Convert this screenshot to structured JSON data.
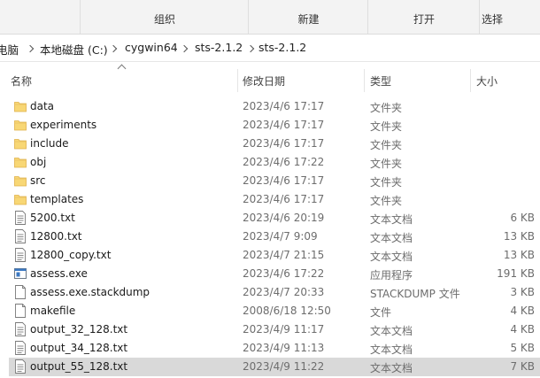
{
  "ribbon": {
    "groups": [
      "组织",
      "新建",
      "打开",
      "选择"
    ]
  },
  "breadcrumb": {
    "items": [
      "电脑",
      "本地磁盘 (C:)",
      "cygwin64",
      "sts-2.1.2",
      "sts-2.1.2"
    ]
  },
  "columns": {
    "name": "名称",
    "date": "修改日期",
    "type": "类型",
    "size": "大小"
  },
  "files": [
    {
      "name": "data",
      "date": "2023/4/6 17:17",
      "type": "文件夹",
      "size": "",
      "icon": "folder-icon"
    },
    {
      "name": "experiments",
      "date": "2023/4/6 17:17",
      "type": "文件夹",
      "size": "",
      "icon": "folder-icon"
    },
    {
      "name": "include",
      "date": "2023/4/6 17:17",
      "type": "文件夹",
      "size": "",
      "icon": "folder-icon"
    },
    {
      "name": "obj",
      "date": "2023/4/6 17:22",
      "type": "文件夹",
      "size": "",
      "icon": "folder-icon"
    },
    {
      "name": "src",
      "date": "2023/4/6 17:17",
      "type": "文件夹",
      "size": "",
      "icon": "folder-icon"
    },
    {
      "name": "templates",
      "date": "2023/4/6 17:17",
      "type": "文件夹",
      "size": "",
      "icon": "folder-icon"
    },
    {
      "name": "5200.txt",
      "date": "2023/4/6 20:19",
      "type": "文本文档",
      "size": "6 KB",
      "icon": "text-file-icon"
    },
    {
      "name": "12800.txt",
      "date": "2023/4/7 9:09",
      "type": "文本文档",
      "size": "13 KB",
      "icon": "text-file-icon"
    },
    {
      "name": "12800_copy.txt",
      "date": "2023/4/7 21:15",
      "type": "文本文档",
      "size": "13 KB",
      "icon": "text-file-icon"
    },
    {
      "name": "assess.exe",
      "date": "2023/4/6 17:22",
      "type": "应用程序",
      "size": "191 KB",
      "icon": "exe-icon"
    },
    {
      "name": "assess.exe.stackdump",
      "date": "2023/4/7 20:33",
      "type": "STACKDUMP 文件",
      "size": "3 KB",
      "icon": "blank-file-icon"
    },
    {
      "name": "makefile",
      "date": "2008/6/18 12:50",
      "type": "文件",
      "size": "4 KB",
      "icon": "blank-file-icon"
    },
    {
      "name": "output_32_128.txt",
      "date": "2023/4/9 11:17",
      "type": "文本文档",
      "size": "4 KB",
      "icon": "text-file-icon"
    },
    {
      "name": "output_34_128.txt",
      "date": "2023/4/9 11:13",
      "type": "文本文档",
      "size": "5 KB",
      "icon": "text-file-icon"
    },
    {
      "name": "output_55_128.txt",
      "date": "2023/4/9 11:22",
      "type": "文本文档",
      "size": "7 KB",
      "icon": "text-file-icon",
      "selected": true
    }
  ],
  "colors": {
    "folder": "#f8d775",
    "folder_dark": "#e8b84a",
    "selected_row": "#d9d9d9",
    "secondary_text": "#6d6d6d"
  }
}
